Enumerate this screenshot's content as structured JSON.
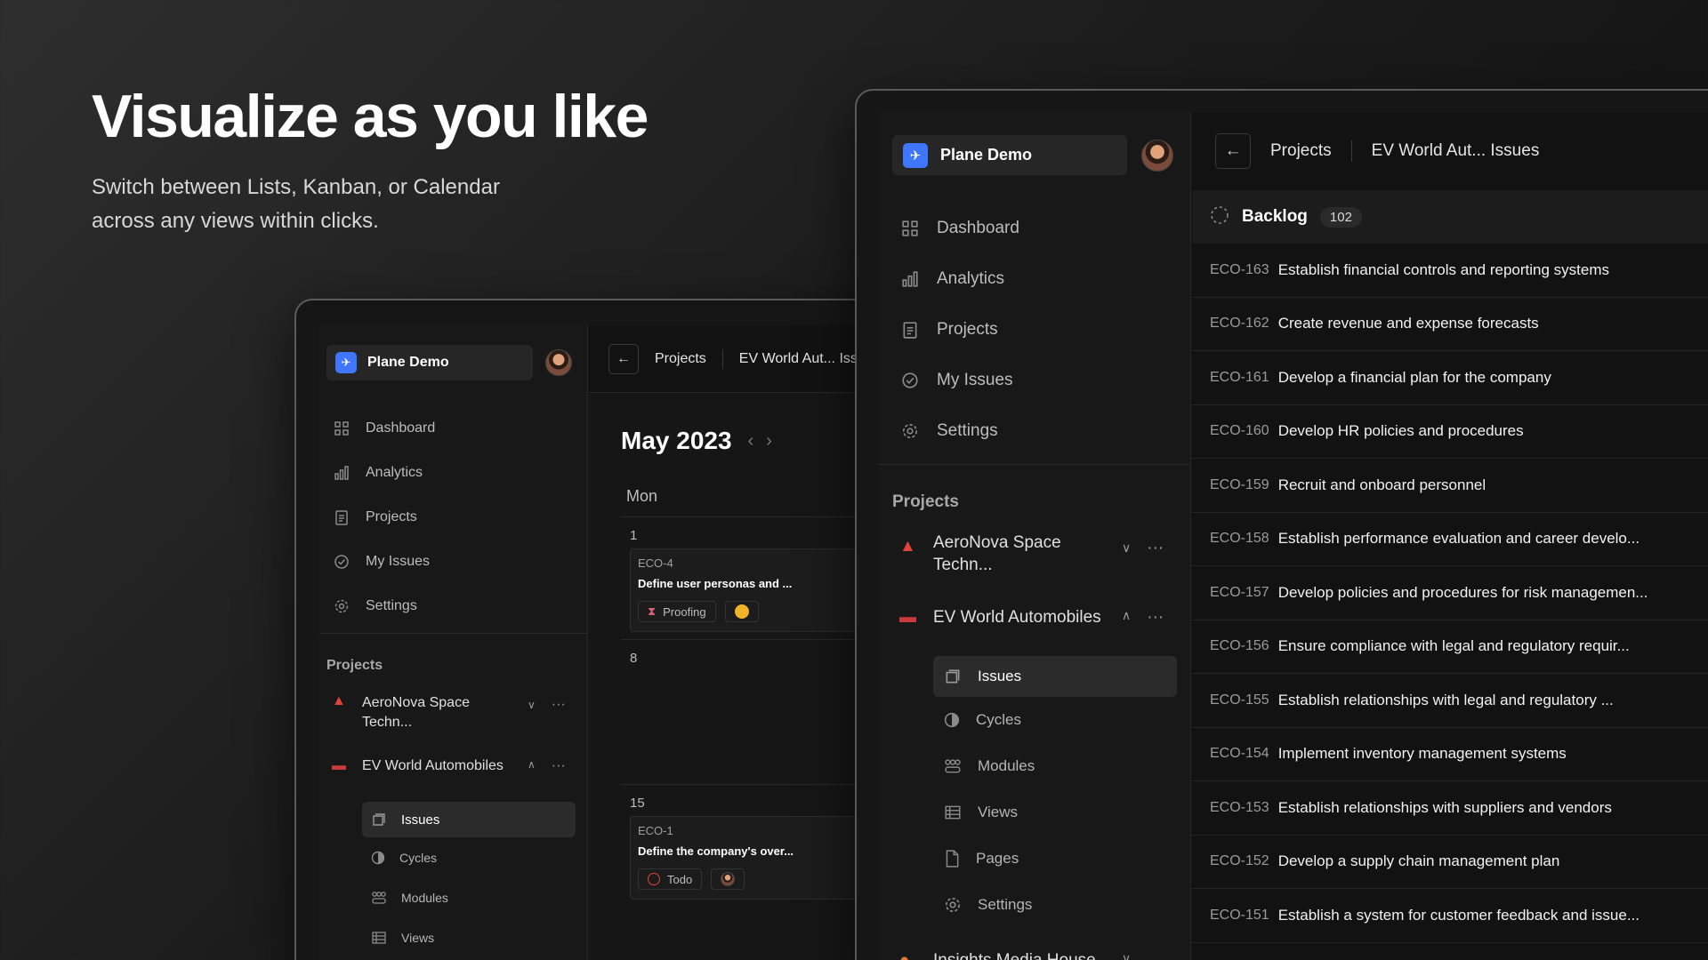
{
  "hero": {
    "title": "Visualize as you like",
    "subtitle_line1": "Switch between Lists, Kanban, or Calendar",
    "subtitle_line2": "across any views within clicks."
  },
  "workspace": {
    "name": "Plane Demo"
  },
  "nav": {
    "dashboard": "Dashboard",
    "analytics": "Analytics",
    "projects": "Projects",
    "my_issues": "My Issues",
    "settings": "Settings"
  },
  "projects_section": {
    "label": "Projects",
    "aeronova_line1": "AeroNova Space",
    "aeronova_line2": "Techn...",
    "ev_world": "EV World Automobiles",
    "insights": "Insights Media House"
  },
  "project_sub": {
    "issues": "Issues",
    "cycles": "Cycles",
    "modules": "Modules",
    "views": "Views",
    "pages": "Pages",
    "settings": "Settings"
  },
  "breadcrumb": {
    "projects": "Projects",
    "current_back": "EV World Aut... Iss",
    "current_front": "EV World Aut... Issues"
  },
  "calendar": {
    "month": "May 2023",
    "day_header": "Mon",
    "cells": [
      {
        "day": "1",
        "issue_id": "ECO-4",
        "issue_title": "Define user personas and ...",
        "state": "Proofing"
      },
      {
        "day": "8"
      },
      {
        "day": "15",
        "issue_id": "ECO-1",
        "issue_title": "Define the company's over...",
        "state": "Todo"
      }
    ]
  },
  "issue_group": {
    "name": "Backlog",
    "count": "102"
  },
  "issues": [
    {
      "id": "ECO-163",
      "title": "Establish financial controls and reporting systems"
    },
    {
      "id": "ECO-162",
      "title": "Create revenue and expense forecasts"
    },
    {
      "id": "ECO-161",
      "title": "Develop a financial plan for the company"
    },
    {
      "id": "ECO-160",
      "title": "Develop HR policies and procedures"
    },
    {
      "id": "ECO-159",
      "title": "Recruit and onboard personnel"
    },
    {
      "id": "ECO-158",
      "title": "Establish performance evaluation and career develo..."
    },
    {
      "id": "ECO-157",
      "title": "Develop policies and procedures for risk managemen..."
    },
    {
      "id": "ECO-156",
      "title": "Ensure compliance with legal and regulatory requir..."
    },
    {
      "id": "ECO-155",
      "title": "Establish relationships with legal and regulatory ..."
    },
    {
      "id": "ECO-154",
      "title": "Implement inventory management systems"
    },
    {
      "id": "ECO-153",
      "title": "Establish relationships with suppliers and vendors"
    },
    {
      "id": "ECO-152",
      "title": "Develop a supply chain management plan"
    },
    {
      "id": "ECO-151",
      "title": "Establish a system for customer feedback and issue..."
    }
  ],
  "icons": {
    "dashboard": "grid-icon",
    "analytics": "bar-chart-icon",
    "projects": "clipboard-icon",
    "my_issues": "check-circle-icon",
    "settings": "gear-icon",
    "issues": "layers-icon",
    "cycles": "cycle-icon",
    "modules": "modules-icon",
    "views": "table-icon",
    "pages": "page-icon"
  },
  "colors": {
    "accent": "#3f76ff",
    "background": "#121212",
    "sidebar": "#181818"
  }
}
